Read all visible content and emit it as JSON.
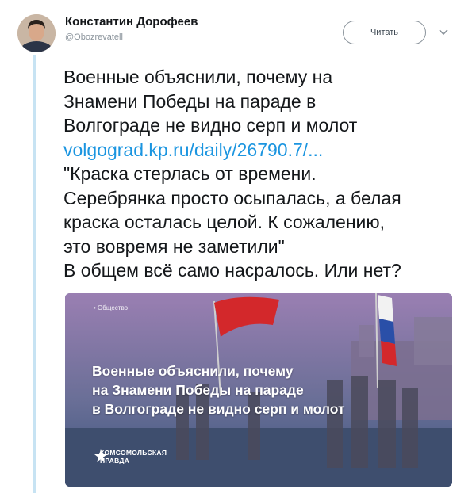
{
  "author": {
    "name": "Константин Дорофеев",
    "handle": "@Obozrevatell"
  },
  "follow_button": {
    "label": "Читать"
  },
  "icons": {
    "avatar": "user-photo",
    "caret": "chevron-down-icon",
    "brand": "star-logo-icon"
  },
  "tweet": {
    "lines": [
      "Военные объяснили, почему на",
      "Знамени Победы на параде в",
      "Волгограде не видно серп и молот",
      "volgograd.kp.ru/daily/26790.7/...",
      "\"Краска стерлась от времени.",
      "Серебрянка просто осыпалась, а белая",
      "краска осталась целой. К сожалению,",
      "это вовремя не заметили\"",
      "В общем всё само насралось. Или нет?"
    ]
  },
  "card": {
    "category": "Общество",
    "headline": [
      "Военные объяснили, почему",
      "на Знамени Победы на параде",
      "в Волгограде не видно серп и молот"
    ],
    "brand": [
      "КОМСОМОЛЬСКАЯ",
      "ПРАВДА"
    ],
    "colors": {
      "overlay_top": "#8a6fa6",
      "overlay_bottom": "#3d5b86",
      "flag_red": "#d3282b"
    }
  },
  "colors": {
    "link": "#1b95e0",
    "thread": "#c7e3f3"
  }
}
